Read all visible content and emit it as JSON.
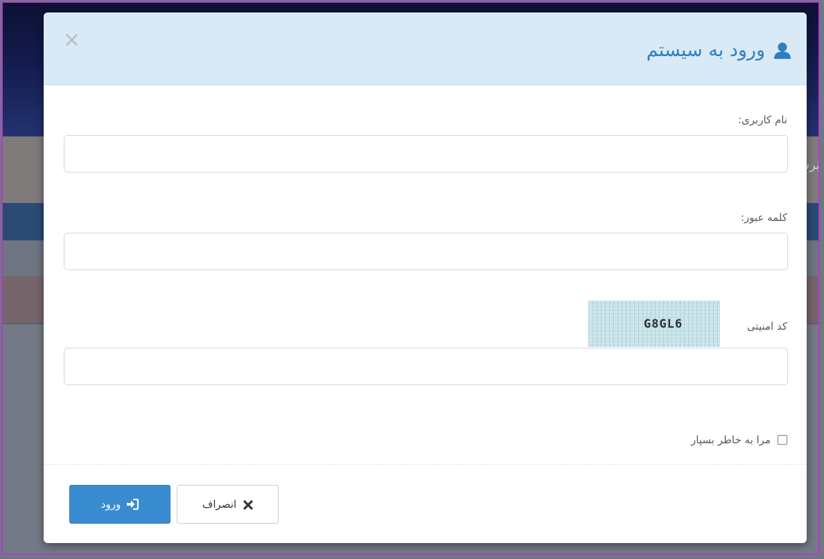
{
  "background": {
    "side_text": "برس"
  },
  "modal": {
    "title": "ورود به سیستم",
    "title_icon": "user-icon",
    "close_label": "×",
    "fields": {
      "username": {
        "label": "نام کاربری:",
        "value": "",
        "placeholder": ""
      },
      "password": {
        "label": "کلمه عبور:",
        "value": "",
        "placeholder": ""
      },
      "captcha": {
        "label": "کد امنیتی",
        "image_text": "G8GL6",
        "value": "",
        "placeholder": ""
      }
    },
    "remember": {
      "label": "مرا به خاطر بسپار",
      "checked": false
    },
    "buttons": {
      "login": {
        "label": "ورود",
        "icon": "sign-in-icon"
      },
      "cancel": {
        "label": "انصراف",
        "icon": "times-icon"
      }
    },
    "colors": {
      "header_bg": "#d9eaf6",
      "title_color": "#2e7fc1",
      "primary_button": "#3a8cd0"
    }
  }
}
